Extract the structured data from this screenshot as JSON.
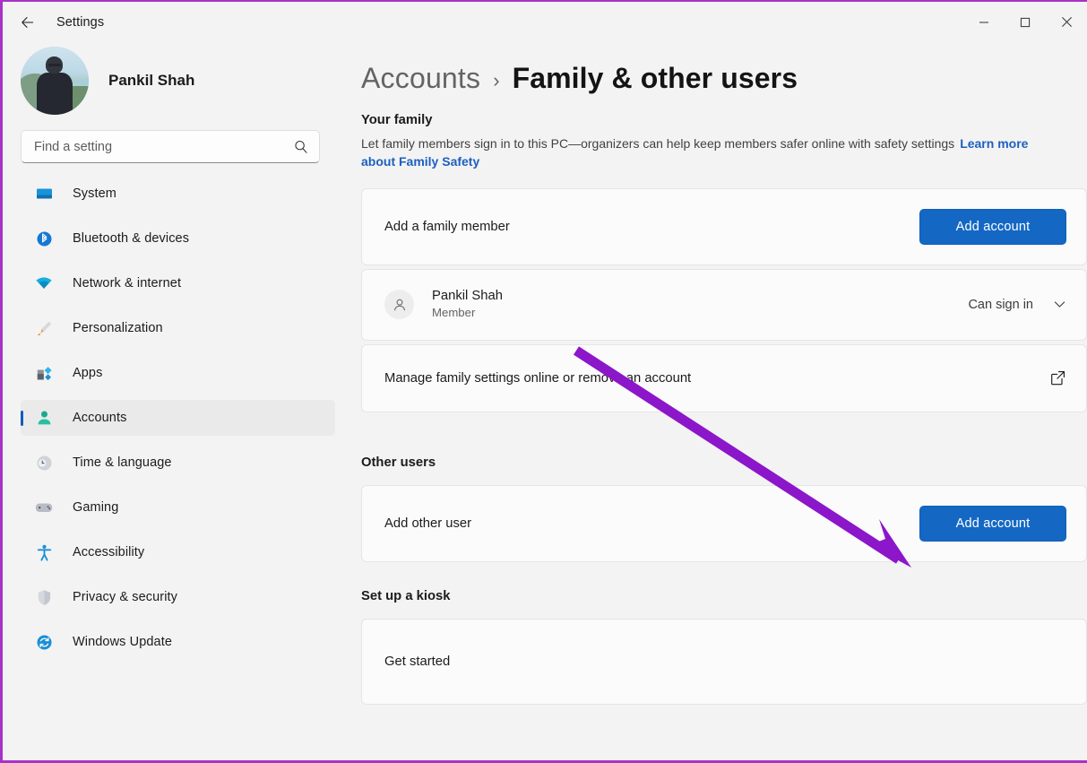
{
  "window": {
    "title": "Settings",
    "back_icon": "back-arrow-icon",
    "minimize_label": "—",
    "maximize_label": "□",
    "close_label": "✕"
  },
  "sidebar": {
    "profile": {
      "name": "Pankil Shah"
    },
    "search": {
      "placeholder": "Find a setting",
      "value": "",
      "icon": "search-icon"
    },
    "items": [
      {
        "label": "System",
        "icon": "monitor-icon",
        "selected": false
      },
      {
        "label": "Bluetooth & devices",
        "icon": "bluetooth-icon",
        "selected": false
      },
      {
        "label": "Network & internet",
        "icon": "wifi-icon",
        "selected": false
      },
      {
        "label": "Personalization",
        "icon": "paintbrush-icon",
        "selected": false
      },
      {
        "label": "Apps",
        "icon": "apps-icon",
        "selected": false
      },
      {
        "label": "Accounts",
        "icon": "person-icon",
        "selected": true
      },
      {
        "label": "Time & language",
        "icon": "clock-globe-icon",
        "selected": false
      },
      {
        "label": "Gaming",
        "icon": "gamepad-icon",
        "selected": false
      },
      {
        "label": "Accessibility",
        "icon": "accessibility-icon",
        "selected": false
      },
      {
        "label": "Privacy & security",
        "icon": "shield-icon",
        "selected": false
      },
      {
        "label": "Windows Update",
        "icon": "update-refresh-icon",
        "selected": false
      }
    ]
  },
  "main": {
    "breadcrumb": {
      "parent": "Accounts",
      "separator": "›",
      "current": "Family & other users"
    },
    "your_family": {
      "heading": "Your family",
      "description": "Let family members sign in to this PC—organizers can help keep members safer online with safety settings",
      "link": "Learn more about Family Safety",
      "add_member": {
        "label": "Add a family member",
        "button": "Add account"
      },
      "member": {
        "name": "Pankil Shah",
        "role": "Member",
        "state": "Can sign in",
        "avatar_icon": "person-avatar-icon",
        "chevron_icon": "chevron-down-icon"
      },
      "manage_online": {
        "label": "Manage family settings online or remove an account",
        "icon": "external-link-icon"
      }
    },
    "other_users": {
      "heading": "Other users",
      "add_other": {
        "label": "Add other user",
        "button": "Add account"
      }
    },
    "kiosk": {
      "heading": "Set up a kiosk",
      "get_started": "Get started"
    }
  },
  "annotation": {
    "arrow_color": "#8c16c9",
    "points_to": "Add account"
  }
}
